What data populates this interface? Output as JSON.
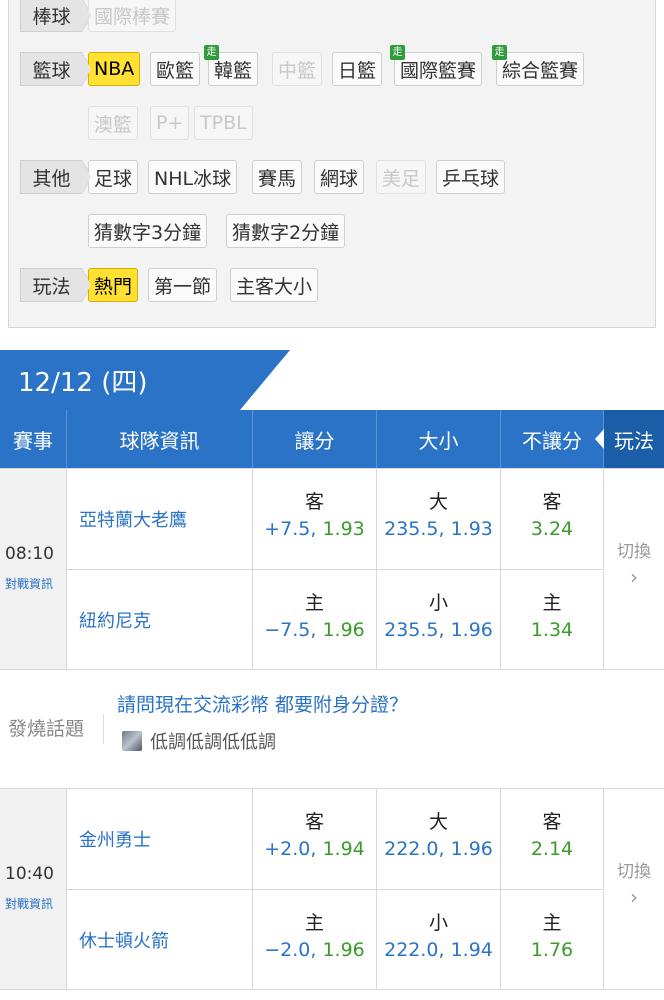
{
  "filters": {
    "baseball": {
      "label": "棒球",
      "chips": [
        {
          "text": "國際棒賽",
          "state": "disabled"
        }
      ]
    },
    "basketball": {
      "label": "籃球",
      "chips": [
        {
          "text": "NBA",
          "state": "active"
        },
        {
          "text": "歐籃",
          "state": "normal"
        },
        {
          "text": "韓籃",
          "state": "normal",
          "badge": "走"
        },
        {
          "text": "中籃",
          "state": "disabled"
        },
        {
          "text": "日籃",
          "state": "normal"
        },
        {
          "text": "國際籃賽",
          "state": "normal",
          "badge": "走"
        },
        {
          "text": "綜合籃賽",
          "state": "normal",
          "badge": "走"
        },
        {
          "text": "澳籃",
          "state": "disabled"
        },
        {
          "text": "P+",
          "state": "disabled"
        },
        {
          "text": "TPBL",
          "state": "disabled"
        }
      ]
    },
    "other": {
      "label": "其他",
      "chips": [
        {
          "text": "足球",
          "state": "normal"
        },
        {
          "text": "NHL冰球",
          "state": "normal"
        },
        {
          "text": "賽馬",
          "state": "normal"
        },
        {
          "text": "網球",
          "state": "normal"
        },
        {
          "text": "美足",
          "state": "disabled"
        },
        {
          "text": "乒乓球",
          "state": "normal"
        },
        {
          "text": "猜數字3分鐘",
          "state": "normal"
        },
        {
          "text": "猜數字2分鐘",
          "state": "normal"
        }
      ]
    },
    "play": {
      "label": "玩法",
      "chips": [
        {
          "text": "熱門",
          "state": "active"
        },
        {
          "text": "第一節",
          "state": "normal"
        },
        {
          "text": "主客大小",
          "state": "normal"
        }
      ]
    }
  },
  "date": "12/12 (四)",
  "columns": {
    "event": "賽事",
    "team": "球隊資訊",
    "handicap": "讓分",
    "overunder": "大小",
    "moneyline": "不讓分",
    "play": "玩法"
  },
  "matches": [
    {
      "time": "08:10",
      "vs_link": "對戰資訊",
      "away": {
        "team": "亞特蘭大老鷹",
        "hcp_side": "客",
        "hcp_line": "+7.5,",
        "hcp_odds": "1.93",
        "ou_side": "大",
        "ou": "235.5, 1.93",
        "ml_side": "客",
        "ml": "3.24"
      },
      "home": {
        "team": "紐約尼克",
        "hcp_side": "主",
        "hcp_line": "−7.5,",
        "hcp_odds": "1.96",
        "ou_side": "小",
        "ou": "235.5, 1.96",
        "ml_side": "主",
        "ml": "1.34"
      },
      "switch": "切換"
    },
    {
      "time": "10:40",
      "vs_link": "對戰資訊",
      "away": {
        "team": "金州勇士",
        "hcp_side": "客",
        "hcp_line": "+2.0,",
        "hcp_odds": "1.94",
        "ou_side": "大",
        "ou": "222.0, 1.96",
        "ml_side": "客",
        "ml": "2.14"
      },
      "home": {
        "team": "休士頓火箭",
        "hcp_side": "主",
        "hcp_line": "−2.0,",
        "hcp_odds": "1.96",
        "ou_side": "小",
        "ou": "222.0, 1.94",
        "ml_side": "主",
        "ml": "1.76"
      },
      "switch": "切換"
    }
  ],
  "topic": {
    "label": "發燒話題",
    "title": "請問現在交流彩幣 都要附身分證？",
    "user": "低調低調低低調"
  },
  "colors": {
    "primary": "#2a73c6",
    "active_chip": "#ffe033",
    "odds_green": "#3a9a2a",
    "live_badge": "#2f9d3a"
  }
}
